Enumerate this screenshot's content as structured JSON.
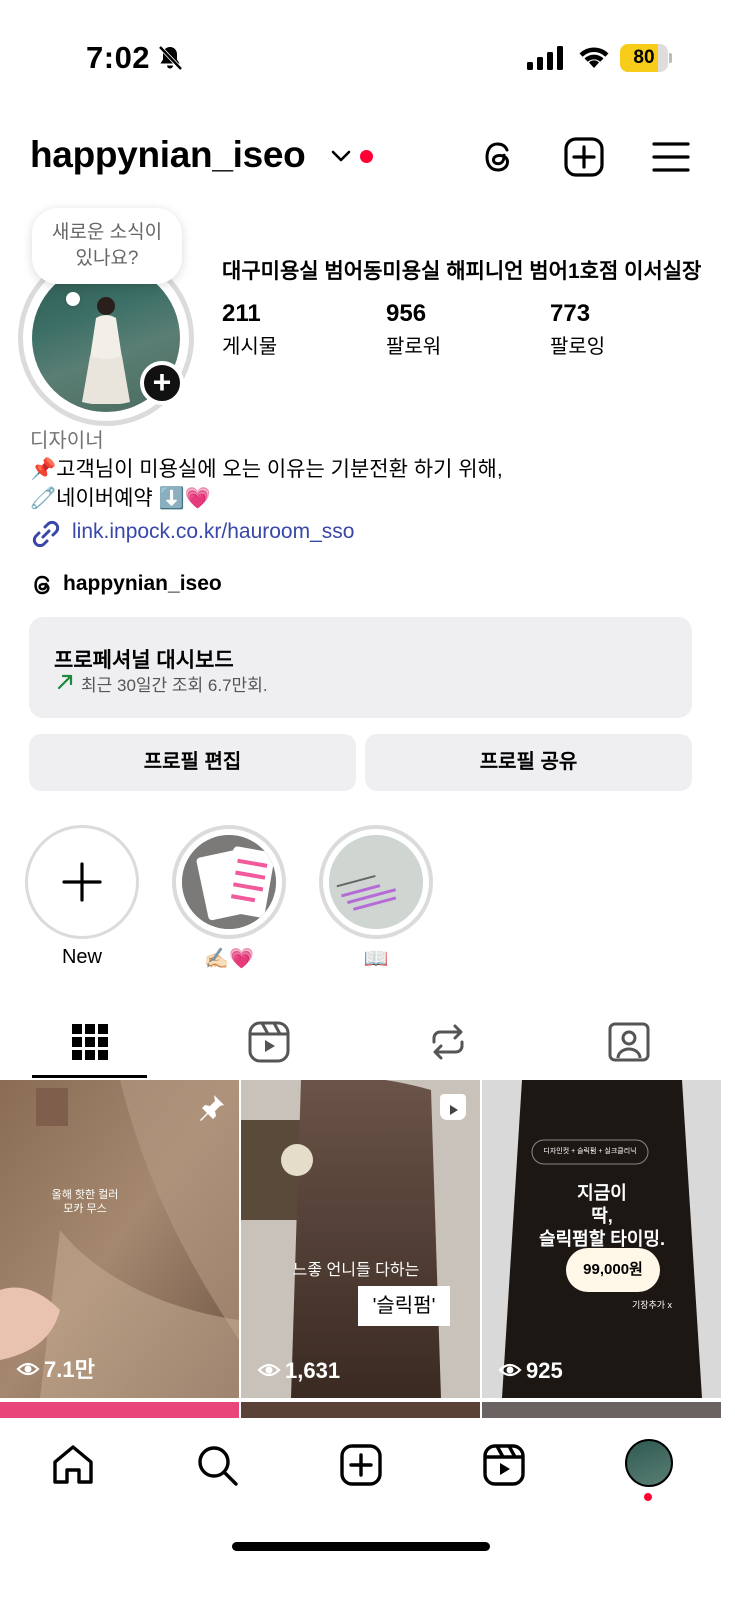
{
  "status_bar": {
    "time": "7:02",
    "battery_level": "80",
    "battery_fraction": 0.8
  },
  "header": {
    "username": "happynian_iseo"
  },
  "profile": {
    "note_bubble": "새로운 소식이\n있나요?",
    "full_name": "대구미용실 범어동미용실 해피니언 범어1호점 이서실장",
    "stats": [
      {
        "value": "211",
        "label": "게시물"
      },
      {
        "value": "956",
        "label": "팔로워"
      },
      {
        "value": "773",
        "label": "팔로잉"
      }
    ],
    "category": "디자이너",
    "bio_lines": [
      "📌고객님이 미용실에 오는 이유는 기분전환 하기 위해,",
      "🧷네이버예약 ⬇️💗"
    ],
    "link": "link.inpock.co.kr/hauroom_sso",
    "threads_handle": "happynian_iseo"
  },
  "dashboard": {
    "title": "프로페셔널 대시보드",
    "subtitle": "최근 30일간 조회 6.7만회."
  },
  "buttons": {
    "edit": "프로필 편집",
    "share": "프로필 공유"
  },
  "highlights": [
    {
      "label": "New"
    },
    {
      "label": "✍🏻💗"
    },
    {
      "label": "📖"
    }
  ],
  "grid": [
    {
      "views": "7.1만",
      "overlay": "올해 핫한 컬러\n모카 무스",
      "pinned": true
    },
    {
      "views": "1,631",
      "overlay": "느좋 언니들 다하는",
      "badge": "'슬릭펌'",
      "reel": true
    },
    {
      "views": "925",
      "overlay": "지금이\n딱,\n슬릭펌할 타이밍.",
      "price": "99,000원",
      "note": "기장추가 x",
      "tagline": "디자인컷 + 슬릭펌 + 실크클리닉"
    }
  ],
  "icons": {
    "threads": "threads-icon",
    "create": "plus-square-icon",
    "menu": "hamburger-menu-icon",
    "grid_tab": "grid-icon",
    "reels_tab": "reels-icon",
    "reposts_tab": "repost-icon",
    "tagged_tab": "tagged-person-icon",
    "nav": [
      "home-icon",
      "search-icon",
      "create-icon",
      "reels-icon",
      "profile-avatar"
    ]
  },
  "colors": {
    "accent_link": "#3947a8",
    "notification_red": "#ff0033",
    "battery": "#f7cd1a"
  }
}
